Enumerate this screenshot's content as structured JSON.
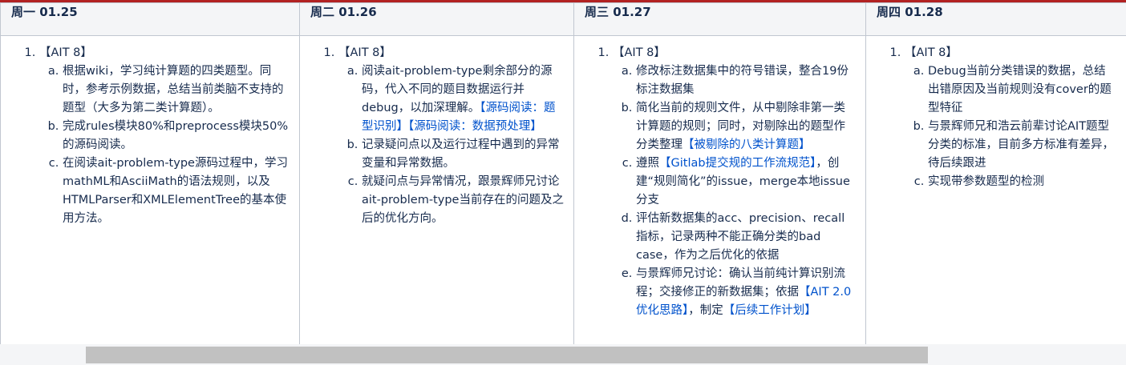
{
  "columns": [
    {
      "header": "周一 01.25",
      "item_label": "【AIT 8】",
      "subitems": [
        [
          {
            "t": "根据wiki，学习纯计算题的四类题型。同时，参考示例数据，总结当前类脑不支持的题型（大多为第二类计算题）。"
          }
        ],
        [
          {
            "t": "完成rules模块80%和preprocess模块50%的源码阅读。"
          }
        ],
        [
          {
            "t": "在阅读ait-problem-type源码过程中，学习mathML和AsciiMath的语法规则，以及HTMLParser和XMLElementTree的基本使用方法。"
          }
        ]
      ]
    },
    {
      "header": "周二 01.26",
      "item_label": "【AIT 8】",
      "subitems": [
        [
          {
            "t": "阅读ait-problem-type剩余部分的源码，代入不同的题目数据运行并debug，以加深理解。"
          },
          {
            "t": "【",
            "link": true
          },
          {
            "t": "源码阅读：题型识别",
            "link": true
          },
          {
            "t": "】【",
            "link": true
          },
          {
            "t": "源码阅读：数据预处理",
            "link": true
          },
          {
            "t": "】",
            "link": true
          }
        ],
        [
          {
            "t": "记录疑问点以及运行过程中遇到的异常变量和异常数据。"
          }
        ],
        [
          {
            "t": "就疑问点与异常情况，跟景辉师兄讨论ait-problem-type当前存在的问题及之后的优化方向。"
          }
        ]
      ]
    },
    {
      "header": "周三 01.27",
      "item_label": "【AIT 8】",
      "subitems": [
        [
          {
            "t": "修改标注数据集中的符号错误，整合19份标注数据集"
          }
        ],
        [
          {
            "t": "简化当前的规则文件，从中剔除非第一类计算题的规则；同时，对剔除出的题型作分类整理"
          },
          {
            "t": "【",
            "link": true
          },
          {
            "t": "被剔除的八类计算题",
            "link": true
          },
          {
            "t": "】",
            "link": true
          }
        ],
        [
          {
            "t": "遵照"
          },
          {
            "t": "【",
            "link": true
          },
          {
            "t": "Gitlab提交规的工作流规范",
            "link": true
          },
          {
            "t": "】",
            "link": true
          },
          {
            "t": "，创建“规则简化”的issue，merge本地issue分支"
          }
        ],
        [
          {
            "t": "评估新数据集的acc、precision、recall指标，记录两种不能正确分类的bad case，作为之后优化的依据"
          }
        ],
        [
          {
            "t": "与景辉师兄讨论：确认当前纯计算识别流程；交接修正的新数据集；依据"
          },
          {
            "t": "【",
            "link": true
          },
          {
            "t": "AIT 2.0优化思路",
            "link": true
          },
          {
            "t": "】",
            "link": true
          },
          {
            "t": "，制定"
          },
          {
            "t": "【",
            "link": true
          },
          {
            "t": "后续工作计划",
            "link": true
          },
          {
            "t": "】",
            "link": true
          }
        ]
      ]
    },
    {
      "header": "周四 01.28",
      "item_label": "【AIT 8】",
      "subitems": [
        [
          {
            "t": "Debug当前分类错误的数据，总结出错原因及当前规则没有cover的题型特征"
          }
        ],
        [
          {
            "t": "与景辉师兄和浩云前辈讨论AIT题型分类的标准，目前多方标准有差异，待后续跟进"
          }
        ],
        [
          {
            "t": "实现带参数题型的检测"
          }
        ]
      ]
    }
  ]
}
